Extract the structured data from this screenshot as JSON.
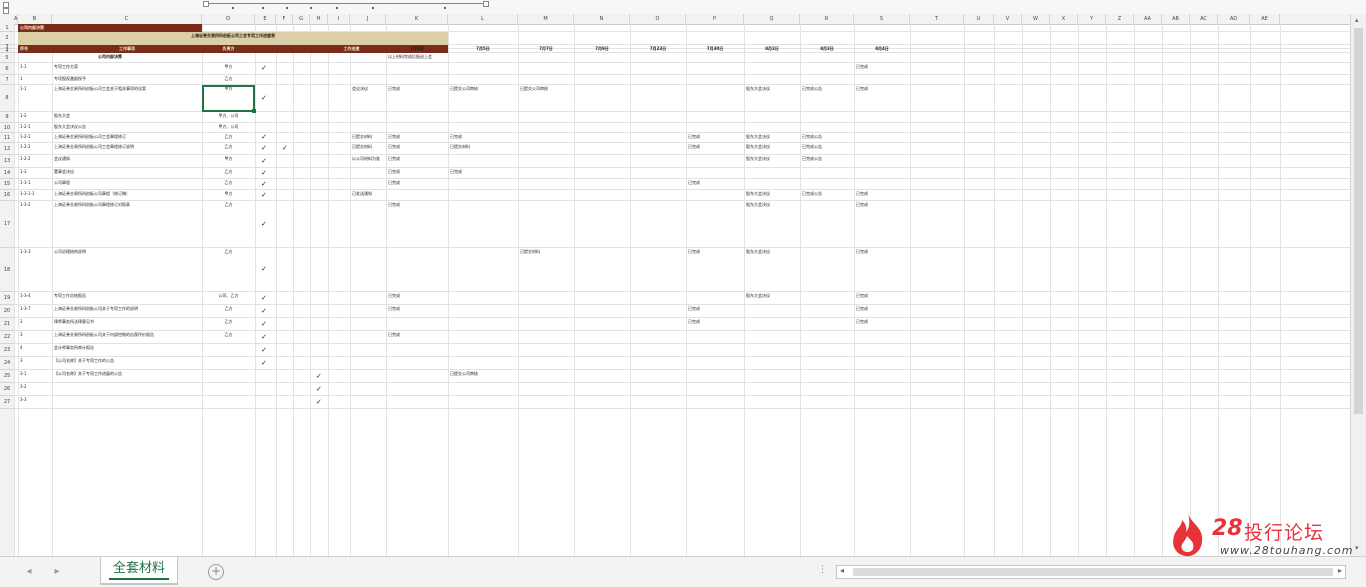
{
  "columns": [
    "A",
    "B",
    "C",
    "D",
    "E",
    "F",
    "G",
    "H",
    "I",
    "J",
    "K",
    "L",
    "M",
    "N",
    "O",
    "P",
    "Q",
    "R",
    "S",
    "T",
    "U",
    "V",
    "W",
    "X",
    "Y",
    "Z",
    "AA",
    "AB",
    "AC",
    "AD",
    "AE"
  ],
  "rows": [
    "1",
    "2",
    "3",
    "4",
    "5",
    "6",
    "7",
    "8",
    "9",
    "10",
    "11",
    "12",
    "13",
    "14",
    "15",
    "16",
    "17",
    "18",
    "19",
    "20",
    "21",
    "22",
    "23",
    "24",
    "25",
    "26",
    "27"
  ],
  "sheet": {
    "tab_label": "全套材料",
    "add_sheet": "+",
    "nav_prev": "◂",
    "nav_next": "▸"
  },
  "scroll": {
    "up": "▴",
    "down": "▾",
    "left": "◂",
    "right": "▸"
  },
  "grid_cells": {
    "title": "上海证券交易所科创板公司工会专项工作进度表",
    "headers": [
      "序号",
      "工作事项",
      "负责方",
      "工作进度",
      "",
      "",
      "",
      ""
    ],
    "dates": [
      "7月2日",
      "7月5日",
      "7月7日",
      "7月9日",
      "7月23日",
      "7月30日",
      "8月2日",
      "8月3日",
      "8月4日"
    ],
    "k_note": "以上材料完成后报送上会",
    "section": "公司内部决策",
    "row_ids": [
      "1-1",
      "1",
      "1-1",
      "1-2",
      "1-2-1",
      "1-2-1",
      "1-2-2",
      "1-2-2",
      "1-3",
      "1-3-1",
      "1-3-1-1",
      "1-3-2",
      "1-3-3",
      "1-3-4",
      "1-3-7",
      "2",
      "3",
      "4",
      "3",
      "3-1",
      "3-2",
      "3-3"
    ],
    "row_a1": "公司内部决策",
    "col_d_values": [
      "甲方",
      "乙方",
      "甲方",
      "甲方、公司",
      "甲方、公司",
      "乙方",
      "乙方",
      "甲方",
      "乙方",
      "乙方",
      "甲方",
      "乙方",
      "乙方",
      "公司、乙方",
      "乙方",
      "乙方",
      "乙方"
    ],
    "items_c": [
      "专项工作方案",
      "专项股权激励授予",
      "上海证券交易所科创板公司工会关于相关事项的议案",
      "股东大会",
      "股东大会决议公告",
      "上海证券交易所科创板公司工会章程修订",
      "上海证券交易所科创板公司工会章程修订说明",
      "会议通知",
      "董事会决议",
      "公司章程",
      "上海证券交易所科创板公司章程（修订稿）",
      "上海证券交易所科创板公司章程修订对照表",
      "公司治理结构说明",
      "专项工作总结报告",
      "上海证券交易所科创板公司关于专项工作的说明",
      "律师事务所法律意见书",
      "上海证券交易所科创板公司关于内部控制的自我评价报告",
      "会计师事务所审计报告",
      "【公司名称】关于专项工作的公告",
      "【公司名称】关于专项工作进展的公告"
    ],
    "j_notes": [
      "会议决议",
      "已提交材料",
      "已提交材料",
      "以公司材料为准",
      "已发送通知"
    ],
    "k_notes": [
      "已完成",
      "已完成",
      "已完成",
      "已完成",
      "已完成",
      "已完成",
      "已完成",
      "已完成",
      "已完成",
      "已完成"
    ],
    "l_notes": [
      "已提交公司审核",
      "已完成",
      "已提交材料",
      "已完成",
      "已提交公司审核"
    ],
    "m_notes": [
      "已提交公司审核",
      "已提交材料"
    ],
    "p_notes": [
      "已完成",
      "已完成",
      "已完成",
      "已完成",
      "已完成",
      "已完成"
    ],
    "q_notes": [
      "股东大会决议",
      "股东大会决议",
      "股东大会决议",
      "股东大会决议",
      "股东大会决议",
      "股东大会决议",
      "股东大会决议",
      "股东大会决议"
    ],
    "r_notes": [
      "已完成公告",
      "已完成公告",
      "已完成公告",
      "已完成公告",
      "已完成公告"
    ],
    "s_notes": [
      "已完成",
      "已完成",
      "已完成",
      "已完成",
      "已完成",
      "已完成",
      "已完成",
      "已完成"
    ]
  },
  "watermark": {
    "number": "28",
    "text": "投行论坛",
    "url": "www.28touhang.com",
    "color": "#e8323a"
  },
  "colors": {
    "title_fill": "#dccfa8",
    "header_fill": "#7b2b1b",
    "header_text": "#f3e7c5",
    "selection": "#217346",
    "accent": "#217346"
  }
}
